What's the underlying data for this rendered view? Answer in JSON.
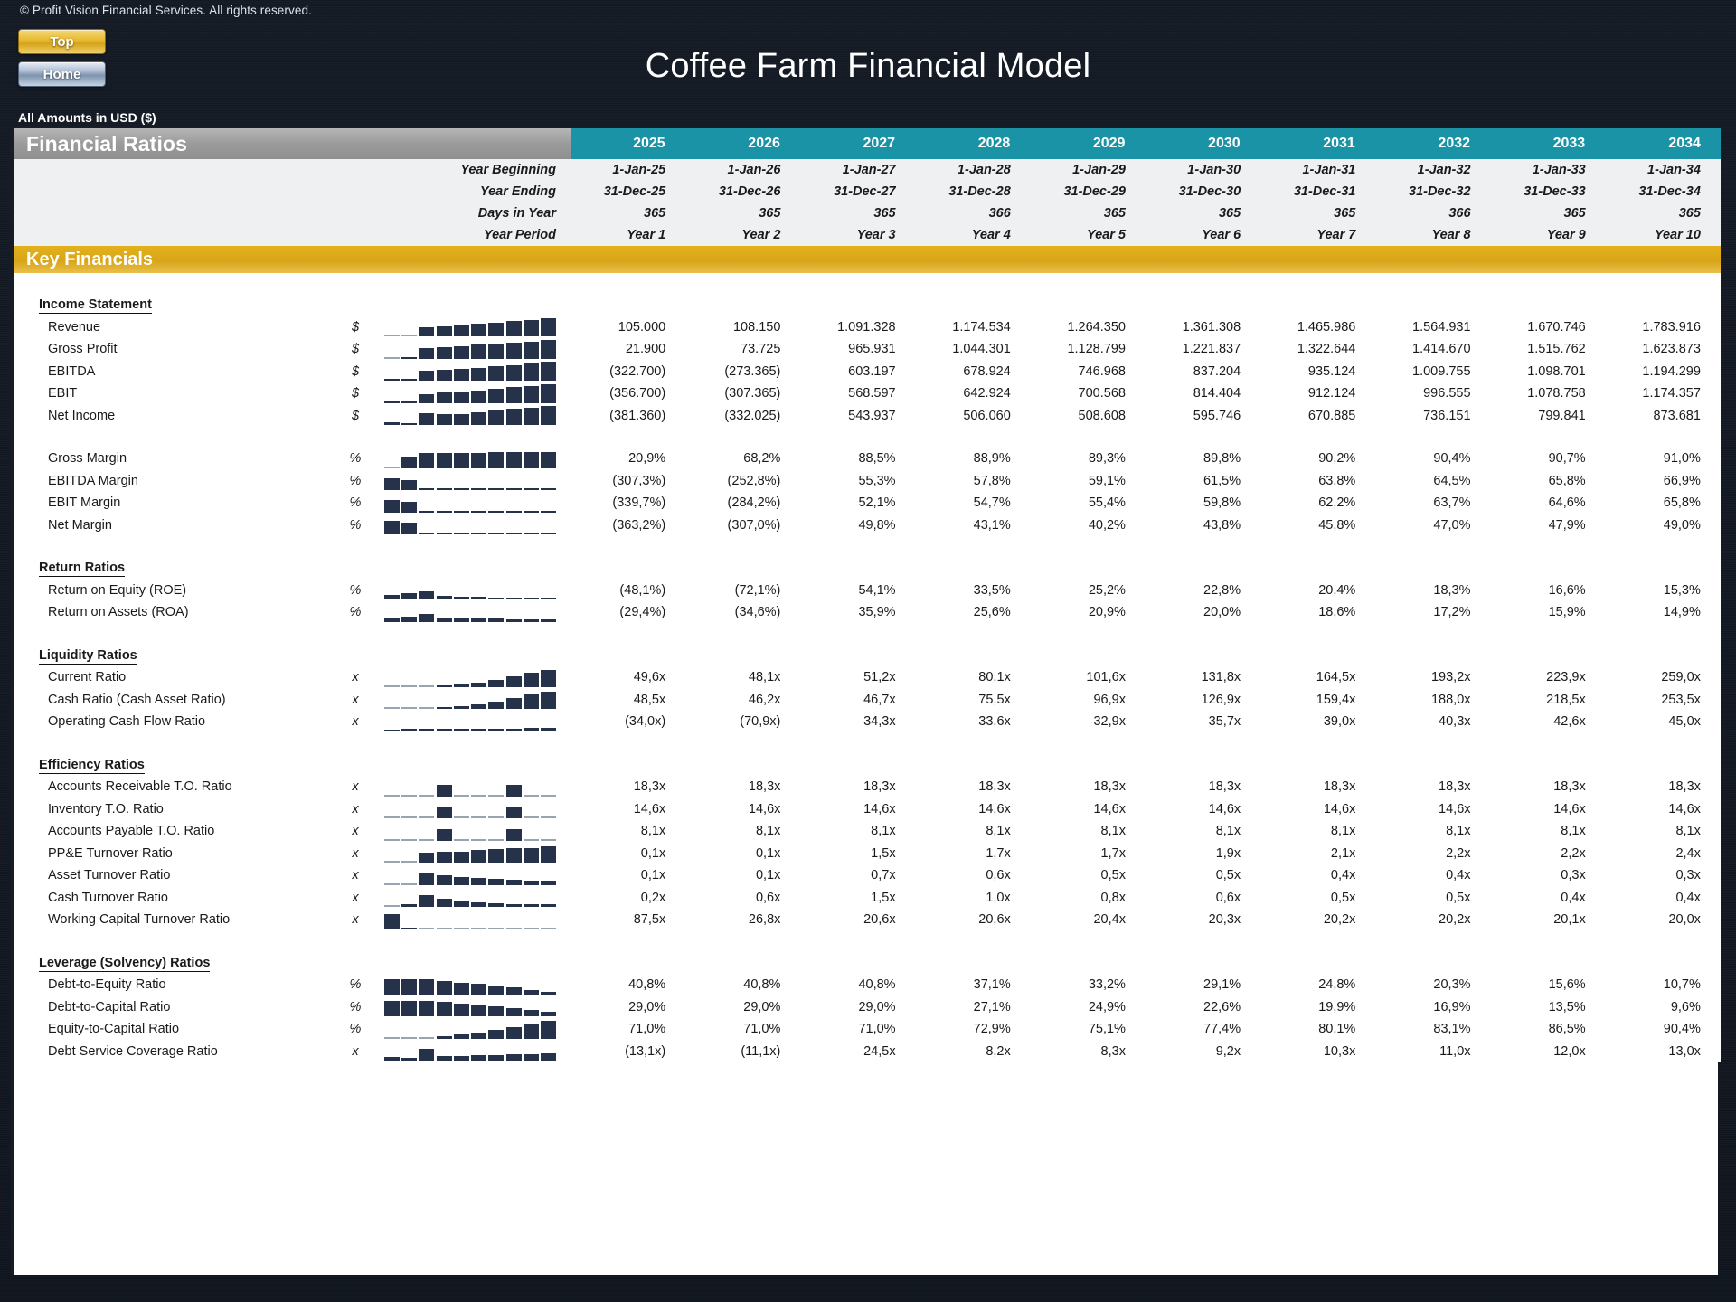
{
  "window": {
    "copyright": "© Profit Vision Financial Services. All rights reserved.",
    "title": "Coffee Farm Financial Model",
    "amounts_note": "All Amounts in  USD ($)"
  },
  "nav": {
    "top_label": "Top",
    "home_label": "Home"
  },
  "header": {
    "section_title": "Financial Ratios",
    "key_financials_label": "Key Financials",
    "years": [
      "2025",
      "2026",
      "2027",
      "2028",
      "2029",
      "2030",
      "2031",
      "2032",
      "2033",
      "2034"
    ],
    "meta_labels": [
      "Year Beginning",
      "Year Ending",
      "Days in Year",
      "Year Period"
    ],
    "year_beginning": [
      "1-Jan-25",
      "1-Jan-26",
      "1-Jan-27",
      "1-Jan-28",
      "1-Jan-29",
      "1-Jan-30",
      "1-Jan-31",
      "1-Jan-32",
      "1-Jan-33",
      "1-Jan-34"
    ],
    "year_ending": [
      "31-Dec-25",
      "31-Dec-26",
      "31-Dec-27",
      "31-Dec-28",
      "31-Dec-29",
      "31-Dec-30",
      "31-Dec-31",
      "31-Dec-32",
      "31-Dec-33",
      "31-Dec-34"
    ],
    "days_in_year": [
      "365",
      "365",
      "365",
      "366",
      "365",
      "365",
      "365",
      "366",
      "365",
      "365"
    ],
    "year_period": [
      "Year 1",
      "Year 2",
      "Year 3",
      "Year 4",
      "Year 5",
      "Year 6",
      "Year 7",
      "Year 8",
      "Year 9",
      "Year 10"
    ]
  },
  "colors": {
    "year_header": "#1b93a6",
    "section_header": "#9b9b9b",
    "key_financials": "#d9a518",
    "spark_bar": "#25324a",
    "gold_button": "#e8bb35"
  },
  "sections": [
    {
      "name": "Income Statement",
      "rows": [
        {
          "label": "Revenue",
          "unit": "$",
          "values": [
            "105.000",
            "108.150",
            "1.091.328",
            "1.174.534",
            "1.264.350",
            "1.361.308",
            "1.465.986",
            "1.564.931",
            "1.670.746",
            "1.783.916"
          ],
          "spark": [
            2,
            2,
            46,
            52,
            58,
            65,
            72,
            80,
            88,
            97
          ]
        },
        {
          "label": "Gross Profit",
          "unit": "$",
          "values": [
            "21.900",
            "73.725",
            "965.931",
            "1.044.301",
            "1.128.799",
            "1.221.837",
            "1.322.644",
            "1.414.670",
            "1.515.762",
            "1.623.873"
          ],
          "spark": [
            2,
            5,
            58,
            63,
            68,
            74,
            80,
            86,
            92,
            99
          ]
        },
        {
          "label": "EBITDA",
          "unit": "$",
          "values": [
            "(322.700)",
            "(273.365)",
            "603.197",
            "678.924",
            "746.968",
            "837.204",
            "935.124",
            "1.009.755",
            "1.098.701",
            "1.194.299"
          ],
          "spark": [
            10,
            9,
            50,
            56,
            62,
            69,
            77,
            83,
            90,
            99
          ]
        },
        {
          "label": "EBIT",
          "unit": "$",
          "values": [
            "(356.700)",
            "(307.365)",
            "568.597",
            "642.924",
            "700.568",
            "814.404",
            "912.124",
            "996.555",
            "1.078.758",
            "1.174.357"
          ],
          "spark": [
            11,
            10,
            48,
            55,
            60,
            69,
            78,
            85,
            92,
            100
          ]
        },
        {
          "label": "Net Income",
          "unit": "$",
          "values": [
            "(381.360)",
            "(332.025)",
            "543.937",
            "506.060",
            "508.608",
            "595.746",
            "670.885",
            "736.151",
            "799.841",
            "873.681"
          ],
          "spark": [
            12,
            11,
            62,
            58,
            58,
            68,
            77,
            84,
            91,
            99
          ]
        }
      ]
    },
    {
      "name": "",
      "rows": [
        {
          "label": "Gross Margin",
          "unit": "%",
          "values": [
            "20,9%",
            "68,2%",
            "88,5%",
            "88,9%",
            "89,3%",
            "89,8%",
            "90,2%",
            "90,4%",
            "90,7%",
            "91,0%"
          ],
          "spark": [
            2,
            62,
            80,
            81,
            82,
            83,
            84,
            84,
            85,
            86
          ]
        },
        {
          "label": "EBITDA Margin",
          "unit": "%",
          "values": [
            "(307,3%)",
            "(252,8%)",
            "55,3%",
            "57,8%",
            "59,1%",
            "61,5%",
            "63,8%",
            "64,5%",
            "65,8%",
            "66,9%"
          ],
          "spark": [
            62,
            52,
            6,
            6,
            6,
            6,
            6,
            6,
            6,
            6
          ]
        },
        {
          "label": "EBIT Margin",
          "unit": "%",
          "values": [
            "(339,7%)",
            "(284,2%)",
            "52,1%",
            "54,7%",
            "55,4%",
            "59,8%",
            "62,2%",
            "63,7%",
            "64,6%",
            "65,8%"
          ],
          "spark": [
            66,
            56,
            6,
            6,
            6,
            6,
            6,
            6,
            6,
            6
          ]
        },
        {
          "label": "Net Margin",
          "unit": "%",
          "values": [
            "(363,2%)",
            "(307,0%)",
            "49,8%",
            "43,1%",
            "40,2%",
            "43,8%",
            "45,8%",
            "47,0%",
            "47,9%",
            "49,0%"
          ],
          "spark": [
            70,
            60,
            6,
            6,
            5,
            6,
            6,
            6,
            6,
            6
          ]
        }
      ]
    },
    {
      "name": "Return Ratios",
      "rows": [
        {
          "label": "Return on Equity (ROE)",
          "unit": "%",
          "values": [
            "(48,1%)",
            "(72,1%)",
            "54,1%",
            "33,5%",
            "25,2%",
            "22,8%",
            "20,4%",
            "18,3%",
            "16,6%",
            "15,3%"
          ],
          "spark": [
            26,
            32,
            44,
            20,
            14,
            12,
            11,
            9,
            8,
            7
          ]
        },
        {
          "label": "Return on Assets (ROA)",
          "unit": "%",
          "values": [
            "(29,4%)",
            "(34,6%)",
            "35,9%",
            "25,6%",
            "20,9%",
            "20,0%",
            "18,6%",
            "17,2%",
            "15,9%",
            "14,9%"
          ],
          "spark": [
            26,
            30,
            44,
            26,
            20,
            19,
            17,
            15,
            13,
            12
          ]
        }
      ]
    },
    {
      "name": "Liquidity Ratios",
      "rows": [
        {
          "label": "Current Ratio",
          "unit": "x",
          "values": [
            "49,6x",
            "48,1x",
            "51,2x",
            "80,1x",
            "101,6x",
            "131,8x",
            "164,5x",
            "193,2x",
            "223,9x",
            "259,0x"
          ],
          "spark": [
            4,
            4,
            4,
            8,
            12,
            24,
            40,
            56,
            74,
            92
          ]
        },
        {
          "label": "Cash Ratio (Cash Asset Ratio)",
          "unit": "x",
          "values": [
            "48,5x",
            "46,2x",
            "46,7x",
            "75,5x",
            "96,9x",
            "126,9x",
            "159,4x",
            "188,0x",
            "218,5x",
            "253,5x"
          ],
          "spark": [
            4,
            4,
            4,
            8,
            12,
            24,
            40,
            56,
            74,
            92
          ]
        },
        {
          "label": "Operating Cash Flow Ratio",
          "unit": "x",
          "values": [
            "(34,0x)",
            "(70,9x)",
            "34,3x",
            "33,6x",
            "32,9x",
            "35,7x",
            "39,0x",
            "40,3x",
            "42,6x",
            "45,0x"
          ],
          "spark": [
            10,
            16,
            14,
            14,
            13,
            14,
            15,
            16,
            17,
            18
          ]
        }
      ]
    },
    {
      "name": "Efficiency Ratios",
      "rows": [
        {
          "label": "Accounts Receivable T.O. Ratio",
          "unit": "x",
          "values": [
            "18,3x",
            "18,3x",
            "18,3x",
            "18,3x",
            "18,3x",
            "18,3x",
            "18,3x",
            "18,3x",
            "18,3x",
            "18,3x"
          ],
          "spark": [
            3,
            3,
            3,
            62,
            3,
            3,
            3,
            62,
            3,
            3
          ]
        },
        {
          "label": "Inventory T.O. Ratio",
          "unit": "x",
          "values": [
            "14,6x",
            "14,6x",
            "14,6x",
            "14,6x",
            "14,6x",
            "14,6x",
            "14,6x",
            "14,6x",
            "14,6x",
            "14,6x"
          ],
          "spark": [
            3,
            3,
            3,
            62,
            3,
            3,
            3,
            62,
            3,
            3
          ]
        },
        {
          "label": "Accounts Payable T.O. Ratio",
          "unit": "x",
          "values": [
            "8,1x",
            "8,1x",
            "8,1x",
            "8,1x",
            "8,1x",
            "8,1x",
            "8,1x",
            "8,1x",
            "8,1x",
            "8,1x"
          ],
          "spark": [
            3,
            3,
            3,
            62,
            3,
            3,
            3,
            62,
            3,
            3
          ]
        },
        {
          "label": "PP&E Turnover Ratio",
          "unit": "x",
          "values": [
            "0,1x",
            "0,1x",
            "1,5x",
            "1,7x",
            "1,7x",
            "1,9x",
            "2,1x",
            "2,2x",
            "2,2x",
            "2,4x"
          ],
          "spark": [
            3,
            3,
            52,
            58,
            58,
            66,
            72,
            76,
            76,
            84
          ]
        },
        {
          "label": "Asset Turnover Ratio",
          "unit": "x",
          "values": [
            "0,1x",
            "0,1x",
            "0,7x",
            "0,6x",
            "0,5x",
            "0,5x",
            "0,4x",
            "0,4x",
            "0,3x",
            "0,3x"
          ],
          "spark": [
            3,
            4,
            62,
            54,
            44,
            40,
            33,
            30,
            24,
            22
          ]
        },
        {
          "label": "Cash Turnover Ratio",
          "unit": "x",
          "values": [
            "0,2x",
            "0,6x",
            "1,5x",
            "1,0x",
            "0,8x",
            "0,6x",
            "0,5x",
            "0,5x",
            "0,4x",
            "0,4x"
          ],
          "spark": [
            3,
            16,
            64,
            44,
            32,
            24,
            18,
            16,
            13,
            12
          ]
        },
        {
          "label": "Working Capital Turnover Ratio",
          "unit": "x",
          "values": [
            "87,5x",
            "26,8x",
            "20,6x",
            "20,6x",
            "20,4x",
            "20,3x",
            "20,2x",
            "20,2x",
            "20,1x",
            "20,0x"
          ],
          "spark": [
            80,
            6,
            3,
            3,
            3,
            3,
            3,
            3,
            3,
            3
          ]
        }
      ]
    },
    {
      "name": "Leverage (Solvency) Ratios",
      "rows": [
        {
          "label": "Debt-to-Equity Ratio",
          "unit": "%",
          "values": [
            "40,8%",
            "40,8%",
            "40,8%",
            "37,1%",
            "33,2%",
            "29,1%",
            "24,8%",
            "20,3%",
            "15,6%",
            "10,7%"
          ],
          "spark": [
            80,
            80,
            80,
            72,
            64,
            56,
            46,
            36,
            25,
            14
          ]
        },
        {
          "label": "Debt-to-Capital Ratio",
          "unit": "%",
          "values": [
            "29,0%",
            "29,0%",
            "29,0%",
            "27,1%",
            "24,9%",
            "22,6%",
            "19,9%",
            "16,9%",
            "13,5%",
            "9,6%"
          ],
          "spark": [
            80,
            80,
            80,
            74,
            68,
            62,
            54,
            45,
            35,
            24
          ]
        },
        {
          "label": "Equity-to-Capital Ratio",
          "unit": "%",
          "values": [
            "71,0%",
            "71,0%",
            "71,0%",
            "72,9%",
            "75,1%",
            "77,4%",
            "80,1%",
            "83,1%",
            "86,5%",
            "90,4%"
          ],
          "spark": [
            4,
            4,
            4,
            14,
            22,
            32,
            48,
            64,
            80,
            94
          ]
        },
        {
          "label": "Debt Service Coverage Ratio",
          "unit": "x",
          "values": [
            "(13,1x)",
            "(11,1x)",
            "24,5x",
            "8,2x",
            "8,3x",
            "9,2x",
            "10,3x",
            "11,0x",
            "12,0x",
            "13,0x"
          ],
          "spark": [
            18,
            16,
            62,
            26,
            26,
            28,
            30,
            32,
            35,
            38
          ]
        }
      ]
    }
  ]
}
